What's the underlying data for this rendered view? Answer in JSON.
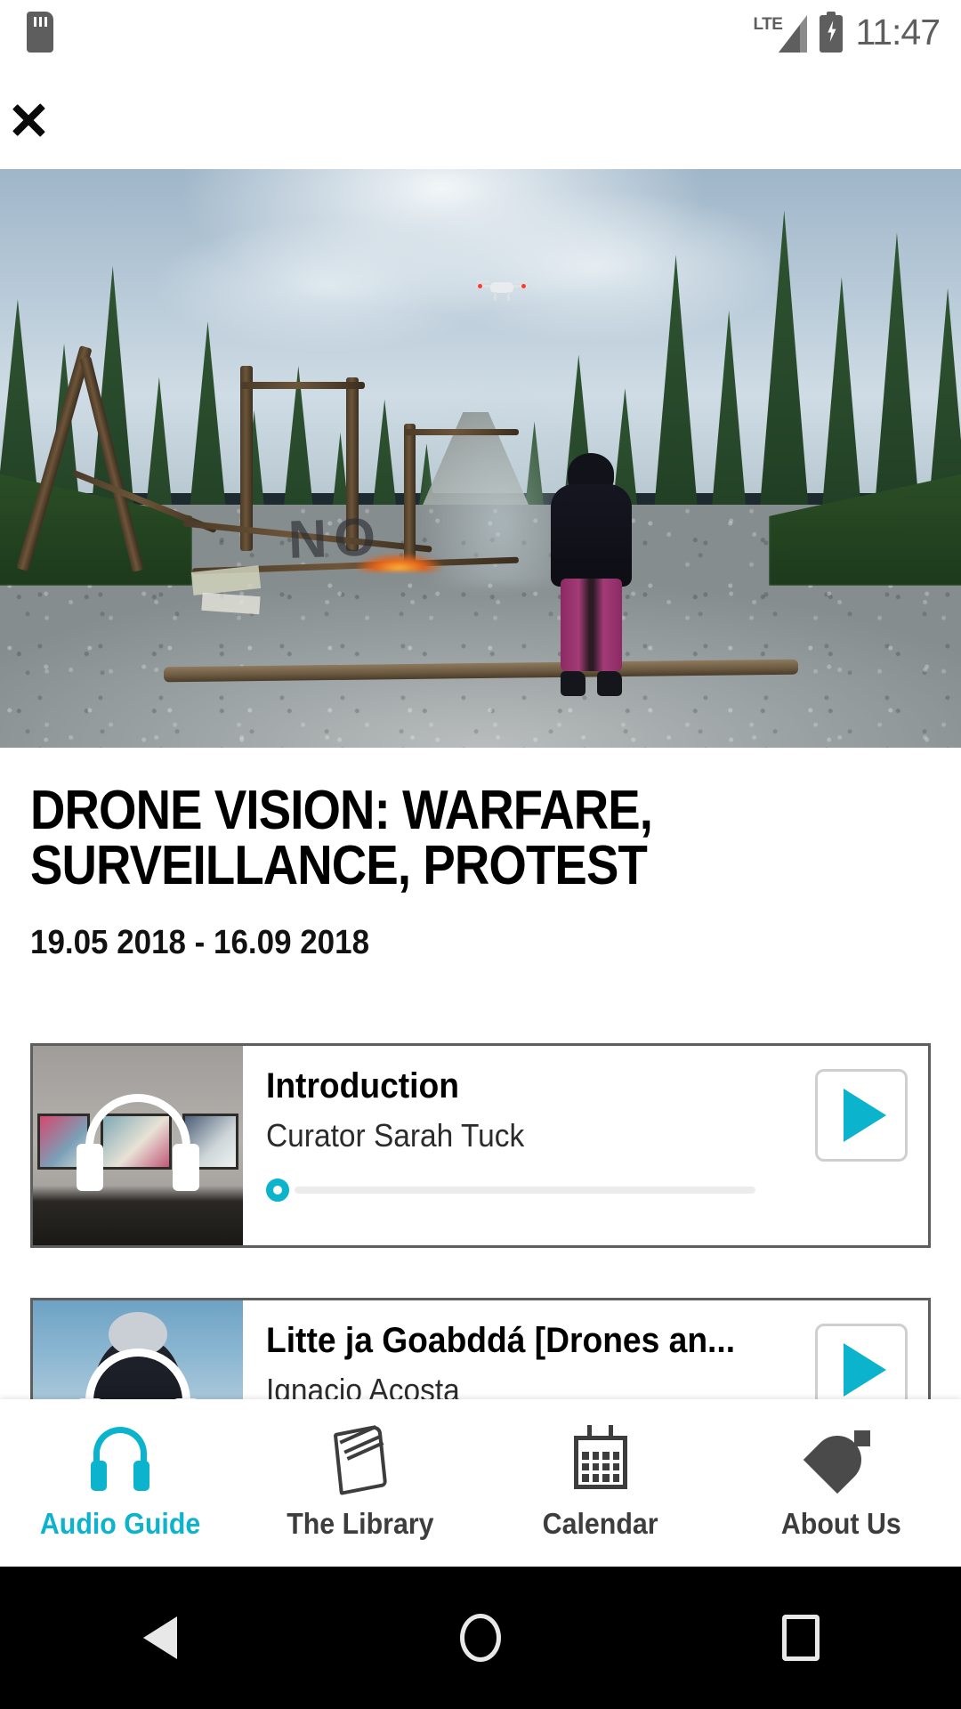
{
  "status_bar": {
    "sd_icon": "sd-card-icon",
    "network_label": "LTE",
    "signal_icon": "signal-bars-icon",
    "battery_icon": "battery-charging-icon",
    "time": "11:47"
  },
  "app_bar": {
    "back_icon": "chevron-left-icon"
  },
  "hero": {
    "alt": "forest-road-barricade-with-drone",
    "road_graffiti": "NO"
  },
  "exhibition": {
    "title": "DRONE VISION: WARFARE, SURVEILLANCE, PROTEST",
    "dates": "19.05 2018 - 16.09 2018"
  },
  "audio_tracks": [
    {
      "title": "Introduction",
      "subtitle": "Curator Sarah Tuck",
      "thumb": "gallery-wall-thumbnail",
      "headphone_icon": "headphones-icon",
      "play_icon": "play-icon",
      "progress": 0
    },
    {
      "title": "Litte ja Goabddá [Drones an...",
      "subtitle": "Ignacio Acosta",
      "thumb": "snow-figure-thumbnail",
      "headphone_icon": "headphones-icon",
      "play_icon": "play-icon",
      "progress": 0
    }
  ],
  "tabs": [
    {
      "label": "Audio Guide",
      "icon": "headphones-icon",
      "active": true
    },
    {
      "label": "The Library",
      "icon": "book-icon",
      "active": false
    },
    {
      "label": "Calendar",
      "icon": "calendar-icon",
      "active": false
    },
    {
      "label": "About Us",
      "icon": "logo-mark-icon",
      "active": false
    }
  ],
  "android_nav": {
    "back_icon": "nav-back-icon",
    "home_icon": "nav-home-icon",
    "recents_icon": "nav-recents-icon"
  },
  "colors": {
    "accent": "#0bb4cc",
    "text": "#000000",
    "muted": "#3d3d3d",
    "card_border": "#5e5e5e"
  }
}
